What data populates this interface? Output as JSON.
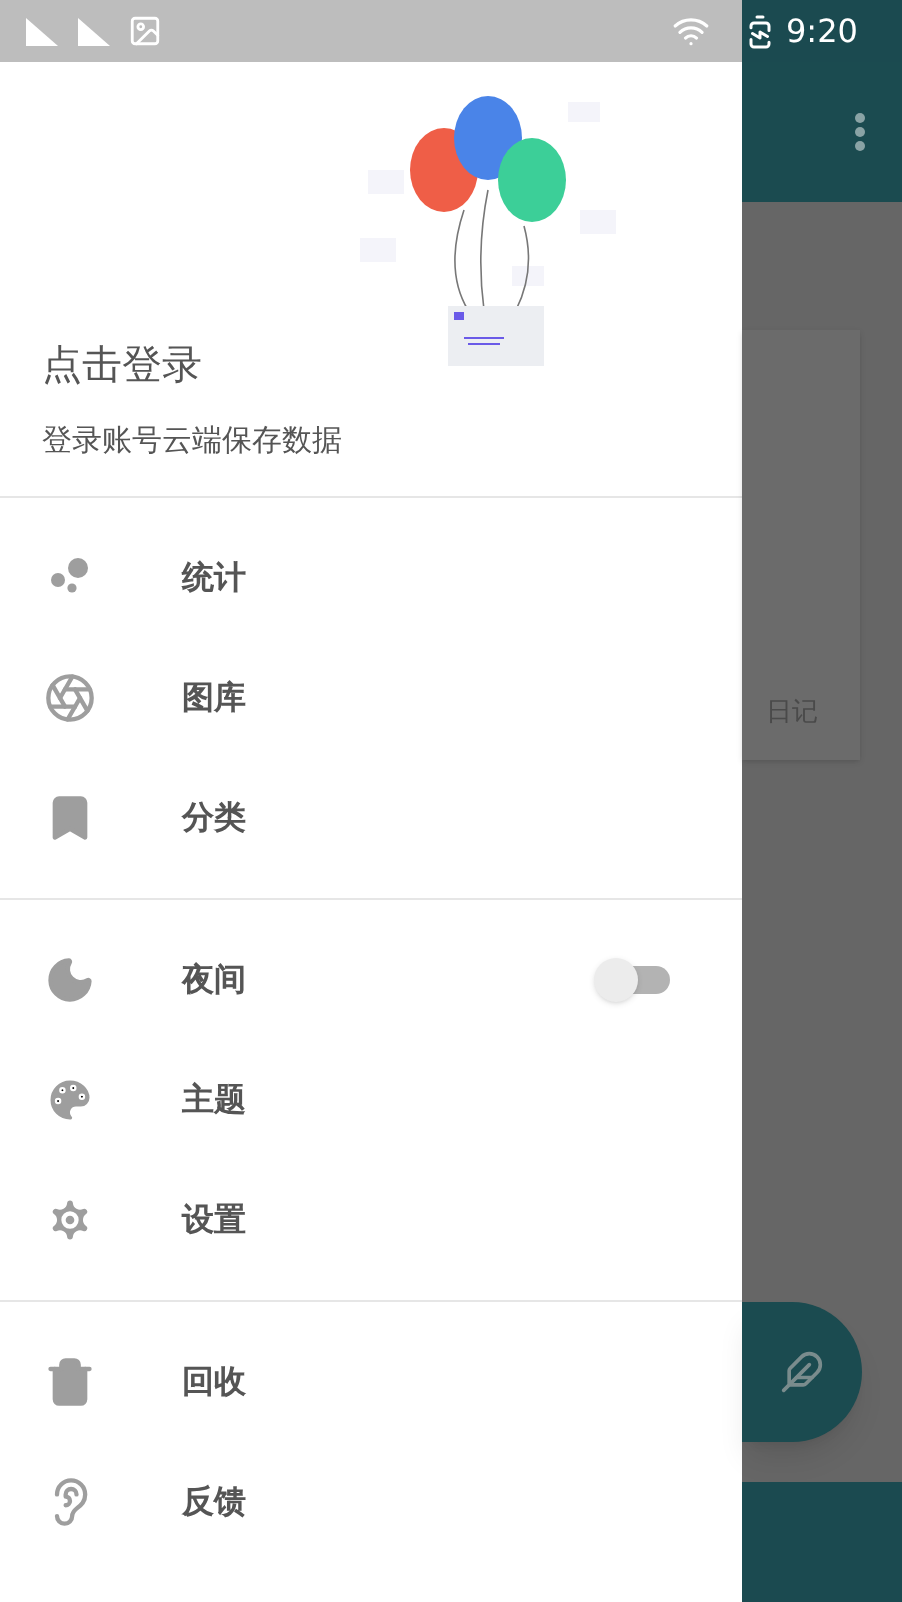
{
  "status_bar": {
    "time": "9:20"
  },
  "drawer": {
    "header": {
      "title": "点击登录",
      "subtitle": "登录账号云端保存数据"
    },
    "sections": [
      [
        {
          "label": "统计",
          "kind": "link"
        },
        {
          "label": "图库",
          "kind": "link"
        },
        {
          "label": "分类",
          "kind": "link"
        }
      ],
      [
        {
          "label": "夜间",
          "kind": "toggle",
          "on": false
        },
        {
          "label": "主题",
          "kind": "link"
        },
        {
          "label": "设置",
          "kind": "link"
        }
      ],
      [
        {
          "label": "回收",
          "kind": "link"
        },
        {
          "label": "反馈",
          "kind": "link"
        }
      ]
    ]
  },
  "background": {
    "card_tag": "日记"
  }
}
